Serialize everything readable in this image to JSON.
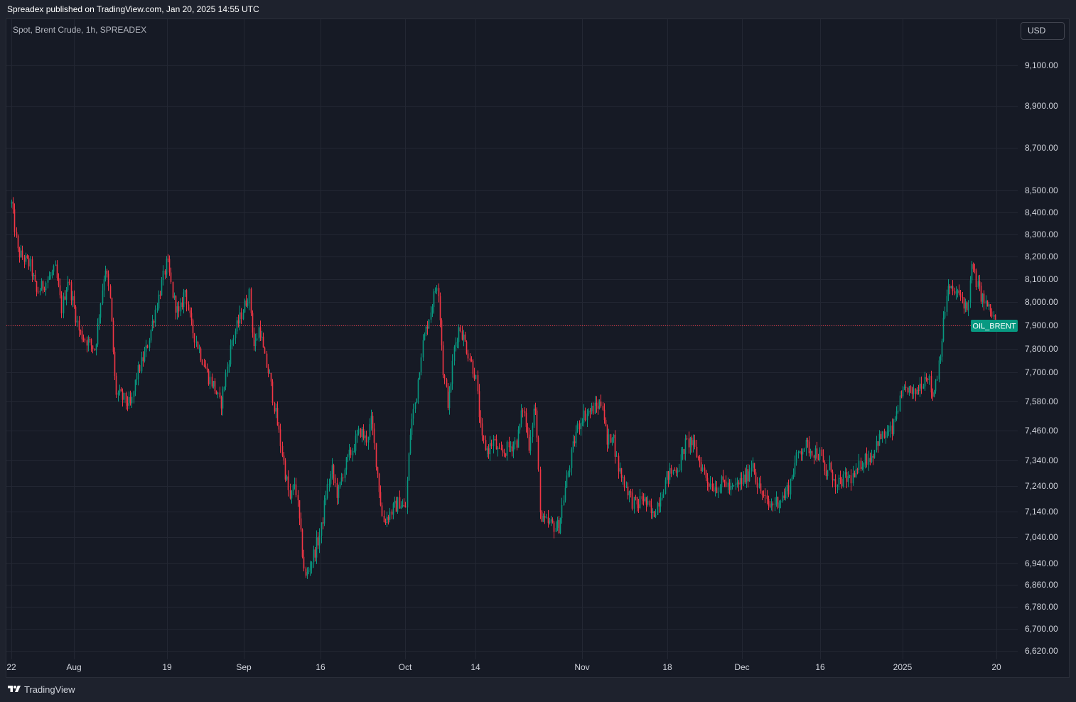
{
  "header": {
    "published": "Spreadex published on TradingView.com, Jan 20, 2025 14:55 UTC"
  },
  "chart": {
    "symbol_label": "Spot, Brent Crude, 1h, SPREADEX",
    "currency": "USD",
    "price_tag": "OIL_BRENT",
    "current_price": 7900,
    "colors": {
      "background": "#161a25",
      "up": "#089981",
      "down": "#f23645",
      "price_tag": "#089981",
      "grid": "#232733",
      "axis_text": "#d1d4dc"
    }
  },
  "footer": {
    "logo_text": "TradingView",
    "logo_icon": "tradingview-logo-icon"
  },
  "chart_data": {
    "type": "candlestick",
    "symbol": "OIL_BRENT",
    "timeframe": "1h",
    "y_ticks": [
      {
        "value": 9100,
        "label": "9,100.00"
      },
      {
        "value": 8900,
        "label": "8,900.00"
      },
      {
        "value": 8700,
        "label": "8,700.00"
      },
      {
        "value": 8500,
        "label": "8,500.00"
      },
      {
        "value": 8400,
        "label": "8,400.00"
      },
      {
        "value": 8300,
        "label": "8,300.00"
      },
      {
        "value": 8200,
        "label": "8,200.00"
      },
      {
        "value": 8100,
        "label": "8,100.00"
      },
      {
        "value": 8000,
        "label": "8,000.00"
      },
      {
        "value": 7900,
        "label": "7,900.00"
      },
      {
        "value": 7800,
        "label": "7,800.00"
      },
      {
        "value": 7700,
        "label": "7,700.00"
      },
      {
        "value": 7580,
        "label": "7,580.00"
      },
      {
        "value": 7460,
        "label": "7,460.00"
      },
      {
        "value": 7340,
        "label": "7,340.00"
      },
      {
        "value": 7240,
        "label": "7,240.00"
      },
      {
        "value": 7140,
        "label": "7,140.00"
      },
      {
        "value": 7040,
        "label": "7,040.00"
      },
      {
        "value": 6940,
        "label": "6,940.00"
      },
      {
        "value": 6860,
        "label": "6,860.00"
      },
      {
        "value": 6780,
        "label": "6,780.00"
      },
      {
        "value": 6700,
        "label": "6,700.00"
      },
      {
        "value": 6620,
        "label": "6,620.00"
      }
    ],
    "x_ticks": [
      {
        "date": "2024-07-22",
        "label": "22"
      },
      {
        "date": "2024-08-01",
        "label": "Aug"
      },
      {
        "date": "2024-08-19",
        "label": "19"
      },
      {
        "date": "2024-09-01",
        "label": "Sep"
      },
      {
        "date": "2024-09-16",
        "label": "16"
      },
      {
        "date": "2024-10-01",
        "label": "Oct"
      },
      {
        "date": "2024-10-14",
        "label": "14"
      },
      {
        "date": "2024-11-01",
        "label": "Nov"
      },
      {
        "date": "2024-11-18",
        "label": "18"
      },
      {
        "date": "2024-12-01",
        "label": "Dec"
      },
      {
        "date": "2024-12-16",
        "label": "16"
      },
      {
        "date": "2025-01-01",
        "label": "2025"
      },
      {
        "date": "2025-01-20",
        "label": "20"
      }
    ],
    "price_path": [
      [
        "2024-07-22",
        8440
      ],
      [
        "2024-07-23",
        8220
      ],
      [
        "2024-07-25",
        8160
      ],
      [
        "2024-07-26",
        8040
      ],
      [
        "2024-07-29",
        8140
      ],
      [
        "2024-07-30",
        7970
      ],
      [
        "2024-07-31",
        8100
      ],
      [
        "2024-08-02",
        7870
      ],
      [
        "2024-08-05",
        7800
      ],
      [
        "2024-08-07",
        8160
      ],
      [
        "2024-08-08",
        8000
      ],
      [
        "2024-08-09",
        7620
      ],
      [
        "2024-08-12",
        7560
      ],
      [
        "2024-08-13",
        7680
      ],
      [
        "2024-08-15",
        7800
      ],
      [
        "2024-08-16",
        7900
      ],
      [
        "2024-08-19",
        8180
      ],
      [
        "2024-08-20",
        8020
      ],
      [
        "2024-08-21",
        7940
      ],
      [
        "2024-08-22",
        8060
      ],
      [
        "2024-08-23",
        7900
      ],
      [
        "2024-08-26",
        7680
      ],
      [
        "2024-08-27",
        7640
      ],
      [
        "2024-08-28",
        7560
      ],
      [
        "2024-08-29",
        7700
      ],
      [
        "2024-08-30",
        7840
      ],
      [
        "2024-09-02",
        8040
      ],
      [
        "2024-09-03",
        7800
      ],
      [
        "2024-09-04",
        7900
      ],
      [
        "2024-09-05",
        7760
      ],
      [
        "2024-09-06",
        7680
      ],
      [
        "2024-09-09",
        7300
      ],
      [
        "2024-09-10",
        7180
      ],
      [
        "2024-09-11",
        7260
      ],
      [
        "2024-09-12",
        7060
      ],
      [
        "2024-09-13",
        6880
      ],
      [
        "2024-09-16",
        7060
      ],
      [
        "2024-09-17",
        7220
      ],
      [
        "2024-09-18",
        7300
      ],
      [
        "2024-09-19",
        7200
      ],
      [
        "2024-09-20",
        7300
      ],
      [
        "2024-09-23",
        7460
      ],
      [
        "2024-09-24",
        7420
      ],
      [
        "2024-09-25",
        7500
      ],
      [
        "2024-09-26",
        7300
      ],
      [
        "2024-09-27",
        7100
      ],
      [
        "2024-09-30",
        7180
      ],
      [
        "2024-10-01",
        7140
      ],
      [
        "2024-10-02",
        7480
      ],
      [
        "2024-10-03",
        7600
      ],
      [
        "2024-10-04",
        7800
      ],
      [
        "2024-10-07",
        8100
      ],
      [
        "2024-10-08",
        7700
      ],
      [
        "2024-10-09",
        7560
      ],
      [
        "2024-10-10",
        7800
      ],
      [
        "2024-10-11",
        7900
      ],
      [
        "2024-10-14",
        7680
      ],
      [
        "2024-10-15",
        7420
      ],
      [
        "2024-10-16",
        7380
      ],
      [
        "2024-10-17",
        7420
      ],
      [
        "2024-10-18",
        7360
      ],
      [
        "2024-10-21",
        7420
      ],
      [
        "2024-10-22",
        7560
      ],
      [
        "2024-10-23",
        7400
      ],
      [
        "2024-10-24",
        7580
      ],
      [
        "2024-10-25",
        7100
      ],
      [
        "2024-10-28",
        7080
      ],
      [
        "2024-10-29",
        7220
      ],
      [
        "2024-10-30",
        7340
      ],
      [
        "2024-10-31",
        7460
      ],
      [
        "2024-11-01",
        7520
      ],
      [
        "2024-11-04",
        7560
      ],
      [
        "2024-11-05",
        7580
      ],
      [
        "2024-11-06",
        7400
      ],
      [
        "2024-11-07",
        7460
      ],
      [
        "2024-11-08",
        7320
      ],
      [
        "2024-11-11",
        7180
      ],
      [
        "2024-11-12",
        7160
      ],
      [
        "2024-11-13",
        7200
      ],
      [
        "2024-11-14",
        7160
      ],
      [
        "2024-11-15",
        7120
      ],
      [
        "2024-11-18",
        7280
      ],
      [
        "2024-11-19",
        7300
      ],
      [
        "2024-11-20",
        7320
      ],
      [
        "2024-11-21",
        7400
      ],
      [
        "2024-11-22",
        7420
      ],
      [
        "2024-11-25",
        7260
      ],
      [
        "2024-11-26",
        7240
      ],
      [
        "2024-11-27",
        7240
      ],
      [
        "2024-11-28",
        7260
      ],
      [
        "2024-11-29",
        7220
      ],
      [
        "2024-12-02",
        7280
      ],
      [
        "2024-12-03",
        7340
      ],
      [
        "2024-12-04",
        7240
      ],
      [
        "2024-12-05",
        7200
      ],
      [
        "2024-12-06",
        7160
      ],
      [
        "2024-12-09",
        7200
      ],
      [
        "2024-12-10",
        7240
      ],
      [
        "2024-12-11",
        7320
      ],
      [
        "2024-12-12",
        7380
      ],
      [
        "2024-12-13",
        7400
      ],
      [
        "2024-12-16",
        7360
      ],
      [
        "2024-12-17",
        7280
      ],
      [
        "2024-12-18",
        7320
      ],
      [
        "2024-12-19",
        7220
      ],
      [
        "2024-12-20",
        7260
      ],
      [
        "2024-12-23",
        7280
      ],
      [
        "2024-12-24",
        7340
      ],
      [
        "2024-12-26",
        7360
      ],
      [
        "2024-12-27",
        7420
      ],
      [
        "2024-12-30",
        7460
      ],
      [
        "2024-12-31",
        7560
      ],
      [
        "2025-01-02",
        7640
      ],
      [
        "2025-01-03",
        7600
      ],
      [
        "2025-01-06",
        7700
      ],
      [
        "2025-01-07",
        7600
      ],
      [
        "2025-01-08",
        7700
      ],
      [
        "2025-01-09",
        7860
      ],
      [
        "2025-01-10",
        8060
      ],
      [
        "2025-01-13",
        8020
      ],
      [
        "2025-01-14",
        7960
      ],
      [
        "2025-01-15",
        8160
      ],
      [
        "2025-01-16",
        8080
      ],
      [
        "2025-01-17",
        8020
      ],
      [
        "2025-01-20",
        7910
      ]
    ],
    "range": {
      "first_close": 8440,
      "high": 8440,
      "low": 6850,
      "last": 7910
    }
  }
}
